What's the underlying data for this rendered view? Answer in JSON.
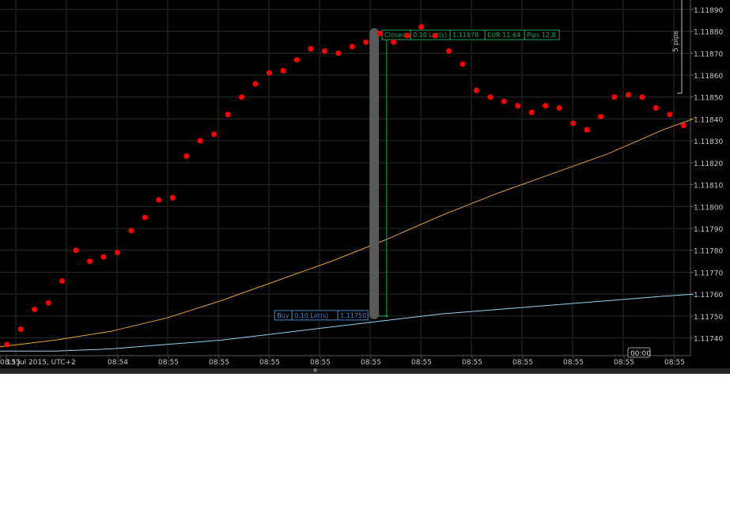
{
  "chart_data": {
    "type": "scatter",
    "price_labels": [
      "1.11890",
      "1.11880",
      "1.11870",
      "1.11860",
      "1.11850",
      "1.11840",
      "1.11830",
      "1.11820",
      "1.11810",
      "1.11800",
      "1.11790",
      "1.11780",
      "1.11770",
      "1.11760",
      "1.11750",
      "1.11740"
    ],
    "time_labels": [
      "13 Jul 2015, UTC+2",
      "08:54",
      "08:55",
      "08:55",
      "08:55",
      "08:55",
      "08:55",
      "08:55",
      "08:55",
      "08:55",
      "08:55",
      "08:55",
      "08:55",
      "08:55"
    ],
    "ylim": [
      1.11733,
      1.11895
    ],
    "xlim": [
      0,
      50
    ],
    "grid": true,
    "series": [
      {
        "kind": "points",
        "color": "#ff0000",
        "x": [
          0.5,
          1.5,
          2.5,
          3.5,
          4.5,
          5.5,
          6.5,
          7.5,
          8.5,
          9.5,
          10.5,
          11.5,
          12.5,
          13.5,
          14.5,
          15.5,
          16.5,
          17.5,
          18.5,
          19.5,
          20.5,
          21.5,
          22.5,
          23.5,
          24.5,
          25.5,
          26.5,
          27.5,
          28.5,
          29.5,
          30.5,
          31.5,
          32.5,
          33.5,
          34.5,
          35.5,
          36.5,
          37.5,
          38.5,
          39.5,
          40.5,
          41.5,
          42.5,
          43.5,
          44.5,
          45.5,
          46.5,
          47.5,
          48.5,
          49.5
        ],
        "y": [
          1.11737,
          1.11744,
          1.11753,
          1.11756,
          1.11766,
          1.1178,
          1.11775,
          1.11777,
          1.11779,
          1.11789,
          1.11795,
          1.11803,
          1.11804,
          1.11823,
          1.1183,
          1.11833,
          1.11842,
          1.1185,
          1.11856,
          1.11861,
          1.11862,
          1.11867,
          1.11872,
          1.11871,
          1.1187,
          1.11873,
          1.11875,
          1.11879,
          1.11875,
          1.11878,
          1.11882,
          1.11878,
          1.11871,
          1.11865,
          1.11853,
          1.1185,
          1.11848,
          1.11846,
          1.11843,
          1.11846,
          1.11845,
          1.11838,
          1.11835,
          1.11841,
          1.1185,
          1.11851,
          1.1185,
          1.11845,
          1.11842,
          1.11837
        ]
      },
      {
        "kind": "line",
        "color": "#e2a23b",
        "x": [
          0,
          4,
          8,
          12,
          16,
          20,
          24,
          28,
          32,
          36,
          40,
          44,
          48,
          50.2
        ],
        "y": [
          1.11736,
          1.11739,
          1.11743,
          1.11749,
          1.11757,
          1.11766,
          1.11775,
          1.11785,
          1.11796,
          1.11806,
          1.11815,
          1.11824,
          1.11835,
          1.1184
        ]
      },
      {
        "kind": "line",
        "color": "#8fd3ee",
        "x": [
          0,
          4,
          8,
          12,
          16,
          20,
          24,
          28,
          32,
          36,
          40,
          44,
          48,
          50.2
        ],
        "y": [
          1.11734,
          1.11734,
          1.11735,
          1.11737,
          1.11739,
          1.11742,
          1.11745,
          1.11748,
          1.11751,
          1.11753,
          1.11755,
          1.11757,
          1.11759,
          1.1176
        ]
      }
    ],
    "trade": {
      "entry_x": 27.1,
      "exit_x": 28.0,
      "open_price": 1.1175,
      "close_price": 1.11878,
      "bar_top": 1.1188,
      "bar_bottom": 1.1175,
      "buy_label": {
        "side": "Buy",
        "lots": "0.10 Lot(s)",
        "price": "1.11750"
      },
      "closed_label": {
        "status": "Closed",
        "lots": "0.10 Lot(s)",
        "price": "1.11878",
        "profit": "EUR 11.64",
        "pips": "Pips 12.8"
      },
      "buy_color": "#4a86c8",
      "closed_color": "#1aa35a"
    },
    "pips_ruler": {
      "label": "5 pips"
    },
    "crosshair_time": "00:00"
  },
  "colors": {
    "background": "#000000",
    "grid": "#2a2a2a",
    "axis_text": "#c8c8c8"
  }
}
